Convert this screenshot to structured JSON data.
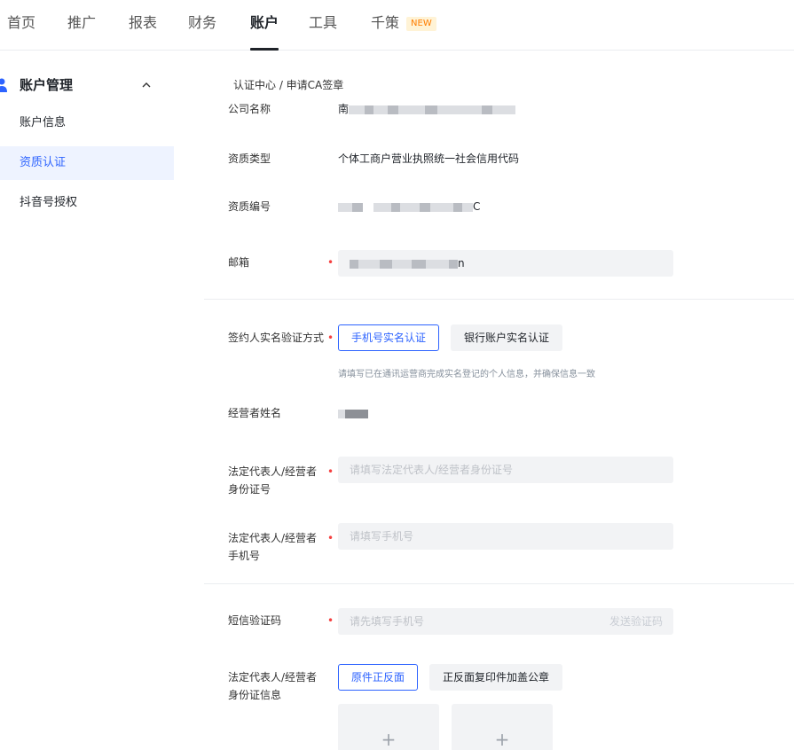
{
  "nav": {
    "items": [
      {
        "label": "首页"
      },
      {
        "label": "推广"
      },
      {
        "label": "报表"
      },
      {
        "label": "财务"
      },
      {
        "label": "账户"
      },
      {
        "label": "工具"
      },
      {
        "label": "千策"
      }
    ],
    "new_badge": "NEW",
    "active_index": 4
  },
  "sidebar": {
    "group_label": "账户管理",
    "items": [
      {
        "label": "账户信息"
      },
      {
        "label": "资质认证"
      },
      {
        "label": "抖音号授权"
      }
    ],
    "active_index": 1
  },
  "breadcrumb": "认证中心 / 申请CA签章",
  "form": {
    "company_name": {
      "label": "公司名称",
      "value_visible": "南"
    },
    "qualification_type": {
      "label": "资质类型",
      "value": "个体工商户营业执照统一社会信用代码"
    },
    "qualification_number": {
      "label": "资质编号",
      "value_visible": "C"
    },
    "email": {
      "label": "邮箱",
      "value_visible": "n"
    },
    "verify_method": {
      "label": "签约人实名验证方式",
      "options": [
        "手机号实名认证",
        "银行账户实名认证"
      ],
      "selected_index": 0,
      "hint": "请填写已在通讯运营商完成实名登记的个人信息，并确保信息一致"
    },
    "operator_name": {
      "label": "经营者姓名"
    },
    "id_number": {
      "label": "法定代表人/经营者身份证号",
      "placeholder": "请填写法定代表人/经营者身份证号"
    },
    "phone": {
      "label": "法定代表人/经营者手机号",
      "placeholder": "请填写手机号"
    },
    "sms_code": {
      "label": "短信验证码",
      "placeholder": "请先填写手机号",
      "send_label": "发送验证码"
    },
    "id_info": {
      "label": "法定代表人/经营者身份证信息",
      "options": [
        "原件正反面",
        "正反面复印件加盖公章"
      ],
      "selected_index": 0
    },
    "required_mark": "•",
    "upload_plus": "+"
  },
  "colors": {
    "accent": "#2d63ff",
    "required": "#f53f3f",
    "badge": "#ff7d00"
  }
}
